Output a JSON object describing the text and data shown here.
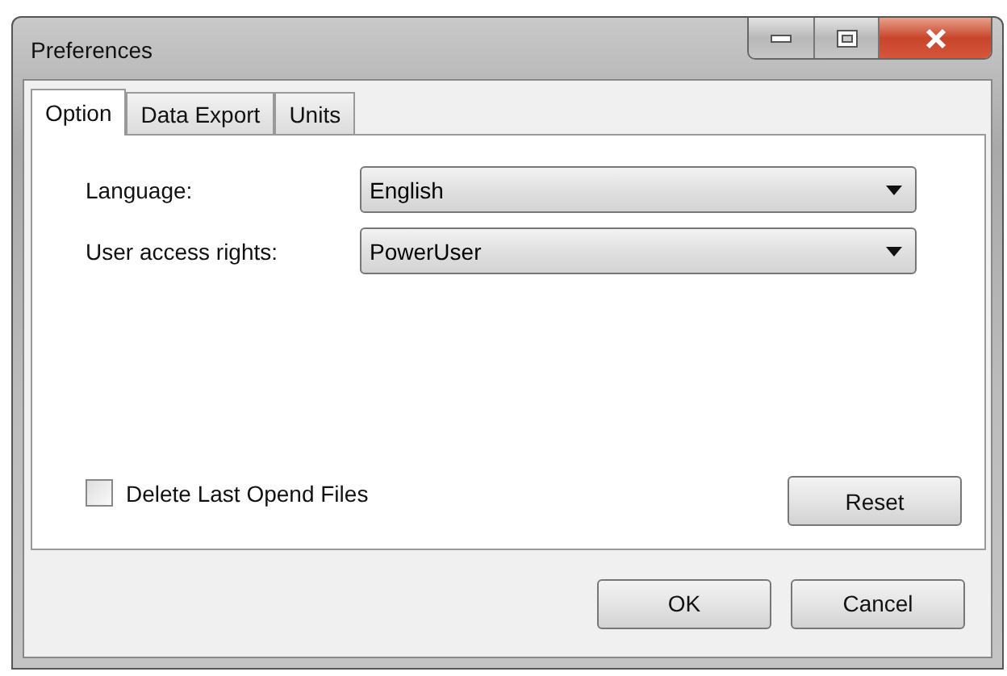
{
  "window": {
    "title": "Preferences"
  },
  "title_buttons": [
    {
      "kind": "minimize"
    },
    {
      "kind": "maximize"
    },
    {
      "kind": "close"
    }
  ],
  "tabs": [
    {
      "label": "Option",
      "selected": true
    },
    {
      "label": "Data Export",
      "selected": false
    },
    {
      "label": "Units",
      "selected": false
    }
  ],
  "fields": [
    {
      "label": "Language:",
      "value": "English"
    },
    {
      "label": "User access rights:",
      "value": "PowerUser"
    }
  ],
  "delete_last_opened": {
    "label": "Delete Last Opend Files",
    "checked": false
  },
  "reset_button": "Reset",
  "buttons": [
    "OK",
    "Cancel"
  ]
}
